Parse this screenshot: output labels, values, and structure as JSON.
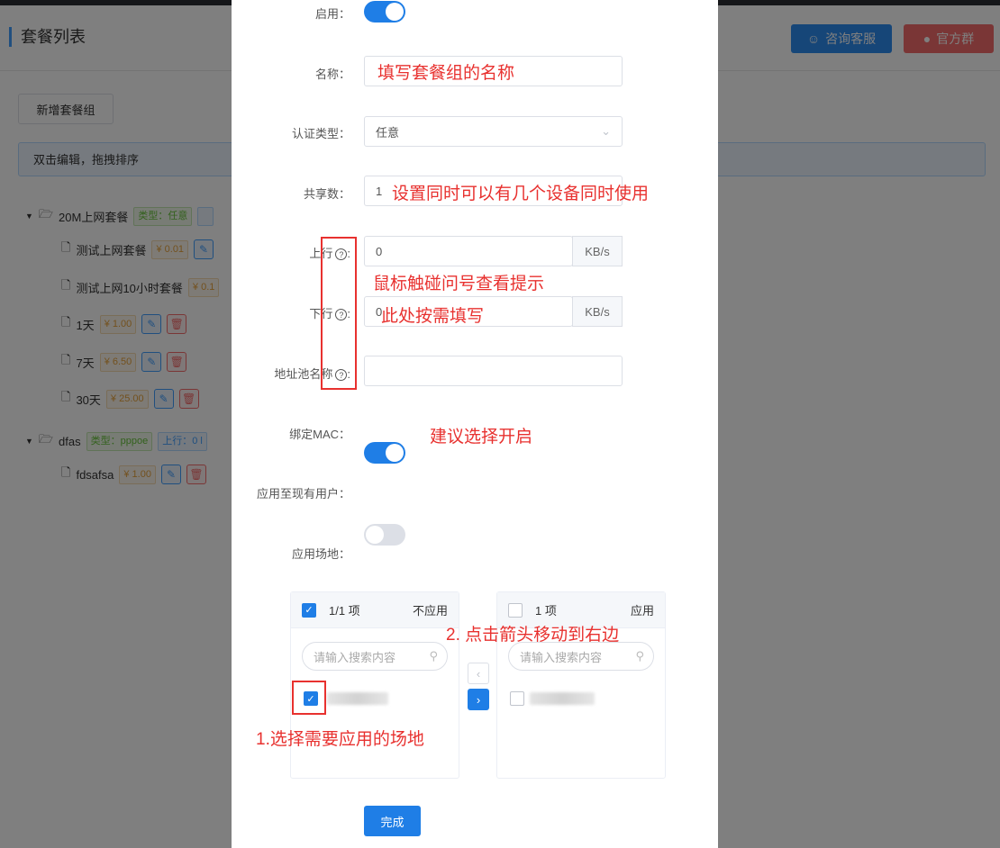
{
  "page": {
    "title": "套餐列表",
    "service_button": "咨询客服",
    "group_button": "官方群",
    "new_group_button": "新增套餐组",
    "tip": "双击编辑，拖拽排序"
  },
  "tree": [
    {
      "label": "20M上网套餐",
      "tags": [
        "类型：任意"
      ],
      "children": [
        {
          "label": "测试上网套餐",
          "price": "¥ 0.01"
        },
        {
          "label": "测试上网10小时套餐",
          "price": "¥ 0.1"
        },
        {
          "label": "1天",
          "price": "¥ 1.00"
        },
        {
          "label": "7天",
          "price": "¥ 6.50"
        },
        {
          "label": "30天",
          "price": "¥ 25.00"
        }
      ]
    },
    {
      "label": "dfas",
      "tags": [
        "类型：pppoe",
        "上行：0 l"
      ],
      "children": [
        {
          "label": "fdsafsa",
          "price": "¥ 1.00"
        }
      ]
    }
  ],
  "form": {
    "enable_label": "启用：",
    "enable_on": true,
    "name_label": "名称：",
    "name_placeholder": "",
    "auth_label": "认证类型：",
    "auth_value": "任意",
    "share_label": "共享数：",
    "share_value": "1",
    "up_label": "上行",
    "up_value": "0",
    "up_unit": "KB/s",
    "down_label": "下行",
    "down_value": "0",
    "down_unit": "KB/s",
    "pool_label": "地址池名称",
    "pool_value": "",
    "colon": ":",
    "mac_label": "绑定MAC：",
    "mac_on": true,
    "apply_users_label": "应用至现有用户：",
    "apply_users_on": false,
    "venue_label": "应用场地：",
    "left_panel": {
      "count": "1/1 项",
      "title": "不应用",
      "search_placeholder": "请输入搜索内容"
    },
    "right_panel": {
      "count": "1 项",
      "title": "应用",
      "search_placeholder": "请输入搜索内容"
    },
    "submit": "完成"
  },
  "annotations": {
    "name_hint": "填写套餐组的名称",
    "share_hint": "设置同时可以有几个设备同时使用",
    "hover_hint": "鼠标触碰问号查看提示",
    "fill_hint": "此处按需填写",
    "mac_hint": "建议选择开启",
    "step2": "2. 点击箭头移动到右边",
    "step1": "1.选择需要应用的场地"
  },
  "colors": {
    "primary": "#1f7ee6",
    "danger": "#f56c6c",
    "annotation": "#e8312f"
  }
}
